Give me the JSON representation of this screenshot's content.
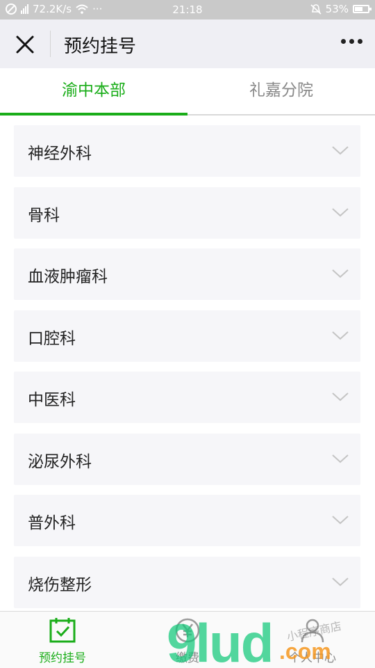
{
  "status_bar": {
    "network_speed": "72.2K/s",
    "dots": "···",
    "time": "21:18",
    "battery_percent": "53%",
    "icons": [
      "blocked-icon",
      "signal-icon",
      "wifi-icon",
      "bell-muted-icon",
      "battery-icon"
    ]
  },
  "header": {
    "title": "预约挂号",
    "close_icon": "close-icon",
    "more_icon": "more-icon"
  },
  "tabs": [
    {
      "label": "渝中本部",
      "active": true
    },
    {
      "label": "礼嘉分院",
      "active": false
    }
  ],
  "departments": [
    {
      "label": "神经外科"
    },
    {
      "label": "骨科"
    },
    {
      "label": "血液肿瘤科"
    },
    {
      "label": "口腔科"
    },
    {
      "label": "中医科"
    },
    {
      "label": "泌尿外科"
    },
    {
      "label": "普外科"
    },
    {
      "label": "烧伤整形"
    }
  ],
  "bottom_nav": [
    {
      "label": "预约挂号",
      "icon": "calendar-check-icon",
      "active": true
    },
    {
      "label": "缴费",
      "icon": "yen-icon",
      "active": false
    },
    {
      "label": "个人中心",
      "icon": "person-icon",
      "active": false
    }
  ],
  "watermark": {
    "main": "9lud",
    "suffix": ".com",
    "shop": "小程序商店"
  },
  "colors": {
    "accent": "#1aad19",
    "header_bg": "#efeff4",
    "row_bg": "#f6f6f9"
  }
}
